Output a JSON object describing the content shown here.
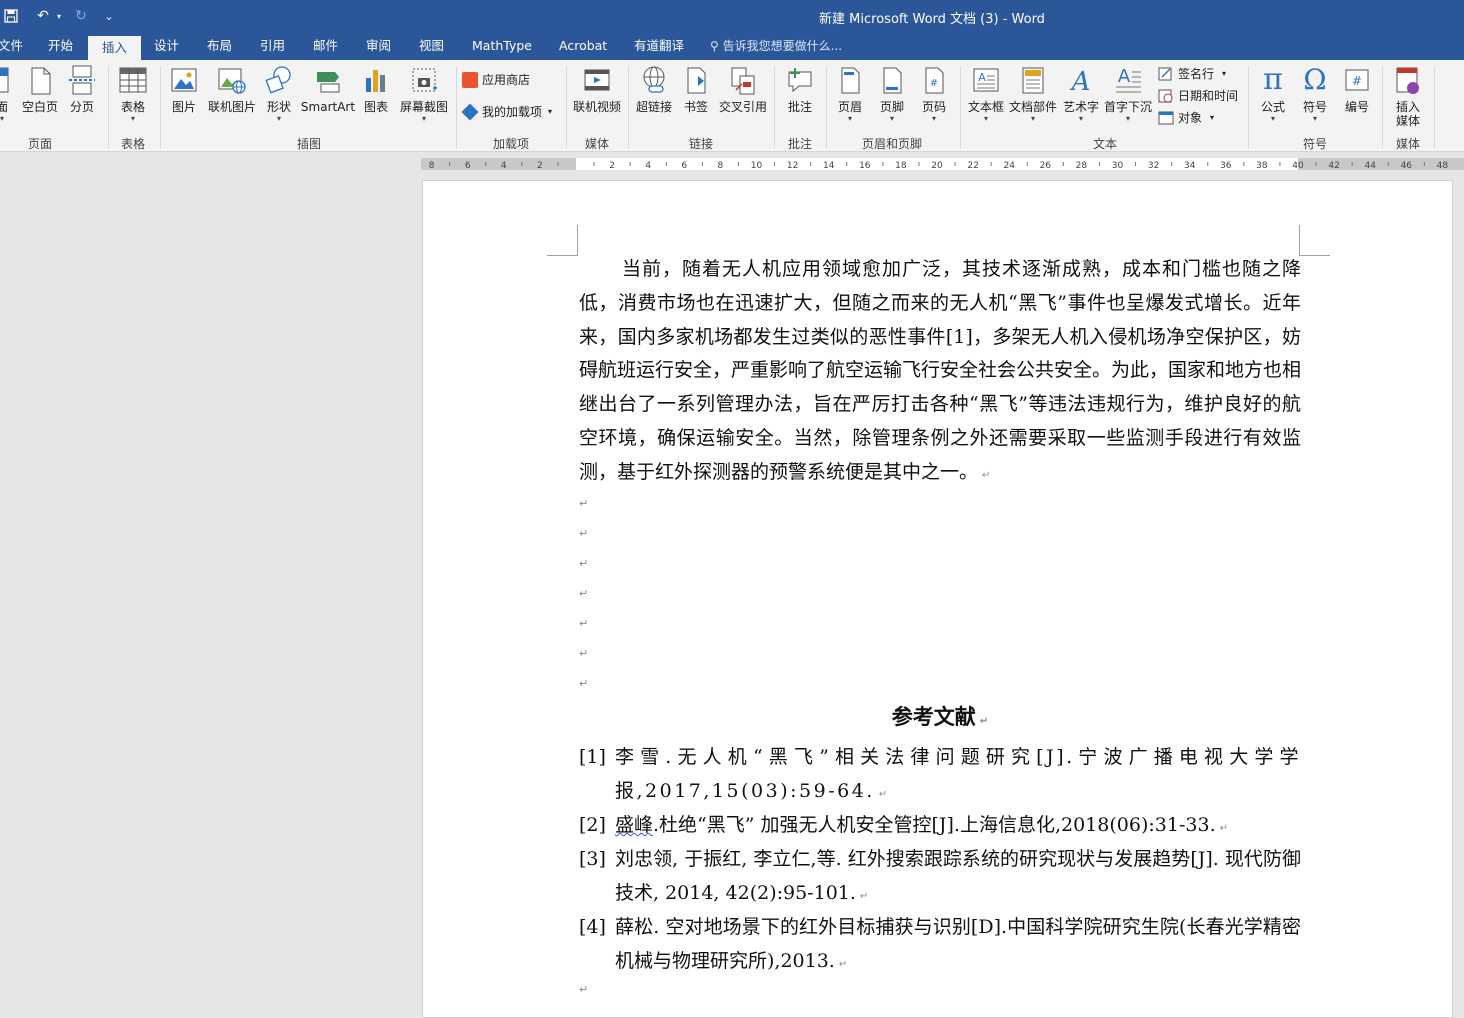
{
  "window": {
    "title": "新建 Microsoft Word 文档 (3) - Word"
  },
  "qat": {
    "save": "💾",
    "undo": "↶",
    "redo": "↻",
    "customize": "⌄"
  },
  "tabs": [
    {
      "label": "文件"
    },
    {
      "label": "开始"
    },
    {
      "label": "插入"
    },
    {
      "label": "设计"
    },
    {
      "label": "布局"
    },
    {
      "label": "引用"
    },
    {
      "label": "邮件"
    },
    {
      "label": "审阅"
    },
    {
      "label": "视图"
    },
    {
      "label": "MathType"
    },
    {
      "label": "Acrobat"
    },
    {
      "label": "有道翻译"
    }
  ],
  "tellme": "告诉我您想要做什么...",
  "ribbon": {
    "pages": {
      "cover": "面",
      "blank": "空白页",
      "break": "分页",
      "group": "页面"
    },
    "tables": {
      "table": "表格",
      "group": "表格"
    },
    "illustrations": {
      "picture": "图片",
      "online_picture": "联机图片",
      "shapes": "形状",
      "smartart": "SmartArt",
      "chart": "图表",
      "screenshot": "屏幕截图",
      "group": "插图"
    },
    "addins": {
      "store": "应用商店",
      "my_addins": "我的加载项",
      "group": "加载项"
    },
    "media": {
      "online_video": "联机视频",
      "group": "媒体"
    },
    "links": {
      "hyperlink": "超链接",
      "bookmark": "书签",
      "crossref": "交叉引用",
      "group": "链接"
    },
    "comments": {
      "comment": "批注",
      "group": "批注"
    },
    "header_footer": {
      "header": "页眉",
      "footer": "页脚",
      "page_number": "页码",
      "group": "页眉和页脚"
    },
    "text": {
      "textbox": "文本框",
      "quickparts": "文档部件",
      "wordart": "艺术字",
      "dropcap": "首字下沉",
      "signature": "签名行",
      "datetime": "日期和时间",
      "object": "对象",
      "group": "文本"
    },
    "symbols": {
      "equation": "公式",
      "symbol": "符号",
      "number": "编号",
      "group": "符号",
      "equation_glyph": "π",
      "symbol_glyph": "Ω"
    },
    "media2": {
      "insert_media_1": "插入",
      "insert_media_2": "媒体",
      "group": "媒体"
    }
  },
  "ruler": {
    "left_labels": [
      "8",
      "6",
      "4",
      "2"
    ],
    "right_labels": [
      "2",
      "4",
      "6",
      "8",
      "10",
      "12",
      "14",
      "16",
      "18",
      "20",
      "22",
      "24",
      "26",
      "28",
      "30",
      "32",
      "34",
      "36",
      "38",
      "40",
      "42",
      "44",
      "46",
      "48"
    ]
  },
  "document": {
    "body": "当前，随着无人机应用领域愈加广泛，其技术逐渐成熟，成本和门槛也随之降低，消费市场也在迅速扩大，但随之而来的无人机“黑飞”事件也呈爆发式增长。近年来，国内多家机场都发生过类似的恶性事件[1]，多架无人机入侵机场净空保护区，妨碍航班运行安全，严重影响了航空运输飞行安全社会公共安全。为此，国家和地方也相继出台了一系列管理办法，旨在严厉打击各种“黑飞”等违法违规行为，维护良好的航空环境，确保运输安全。当然，除管理条例之外还需要采取一些监测手段进行有效监测，基于红外探测器的预警系统便是其中之一。",
    "para_mark": "↵",
    "ref_heading": "参考文献",
    "refs": [
      {
        "num": "[1]",
        "text": "李雪.无人机“黑飞”相关法律问题研究[J].宁波广播电视大学学报,2017,15(03):59-64."
      },
      {
        "num": "[2]",
        "name": "盛峰",
        "text": ".杜绝“黑飞” 加强无人机安全管控[J].上海信息化,2018(06):31-33."
      },
      {
        "num": "[3]",
        "text": "刘忠领, 于振红, 李立仁,等. 红外搜索跟踪系统的研究现状与发展趋势[J]. 现代防御技术, 2014, 42(2):95-101."
      },
      {
        "num": "[4]",
        "text": "薛松. 空对地场景下的红外目标捕获与识别[D].中国科学院研究生院(长春光学精密机械与物理研究所),2013."
      }
    ]
  }
}
